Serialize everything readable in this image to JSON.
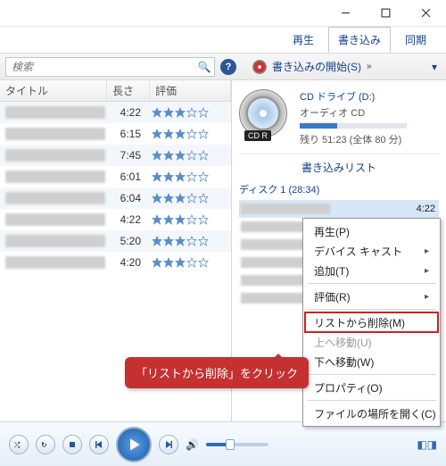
{
  "titlebar": {
    "min": "—",
    "max": "☐",
    "close": "✕"
  },
  "tabs": {
    "play": "再生",
    "burn": "書き込み",
    "sync": "同期"
  },
  "toolbar": {
    "search_placeholder": "検索",
    "burn_start": "書き込みの開始(S)",
    "chev": "»",
    "menuchev": "▾"
  },
  "columns": {
    "title": "タイトル",
    "length": "長さ",
    "rating": "評価"
  },
  "tracks": [
    {
      "length": "4:22",
      "stars": 3
    },
    {
      "length": "6:15",
      "stars": 3
    },
    {
      "length": "7:45",
      "stars": 3
    },
    {
      "length": "6:01",
      "stars": 3
    },
    {
      "length": "6:04",
      "stars": 3
    },
    {
      "length": "4:22",
      "stars": 3
    },
    {
      "length": "5:20",
      "stars": 3
    },
    {
      "length": "4:20",
      "stars": 3
    }
  ],
  "cd": {
    "badge": "CD R",
    "drive": "CD ドライブ (D:)",
    "type": "オーディオ CD",
    "remaining": "残り 51:23 (全体 80 分)"
  },
  "burnlist": {
    "header": "書き込みリスト",
    "disc": "ディスク 1 (28:34)",
    "items": [
      {
        "time": "4:22",
        "selected": true
      },
      {
        "time": ""
      },
      {
        "time": ""
      },
      {
        "time": ""
      },
      {
        "time": ""
      },
      {
        "time": ""
      }
    ]
  },
  "context_menu": {
    "play": "再生(P)",
    "cast": "デバイス キャスト",
    "add": "追加(T)",
    "rate": "評価(R)",
    "remove": "リストから削除(M)",
    "moveup": "上へ移動(U)",
    "movedown": "下へ移動(W)",
    "property": "プロパティ(O)",
    "openloc": "ファイルの場所を開く(C)"
  },
  "callout": "「リストから削除」をクリック"
}
